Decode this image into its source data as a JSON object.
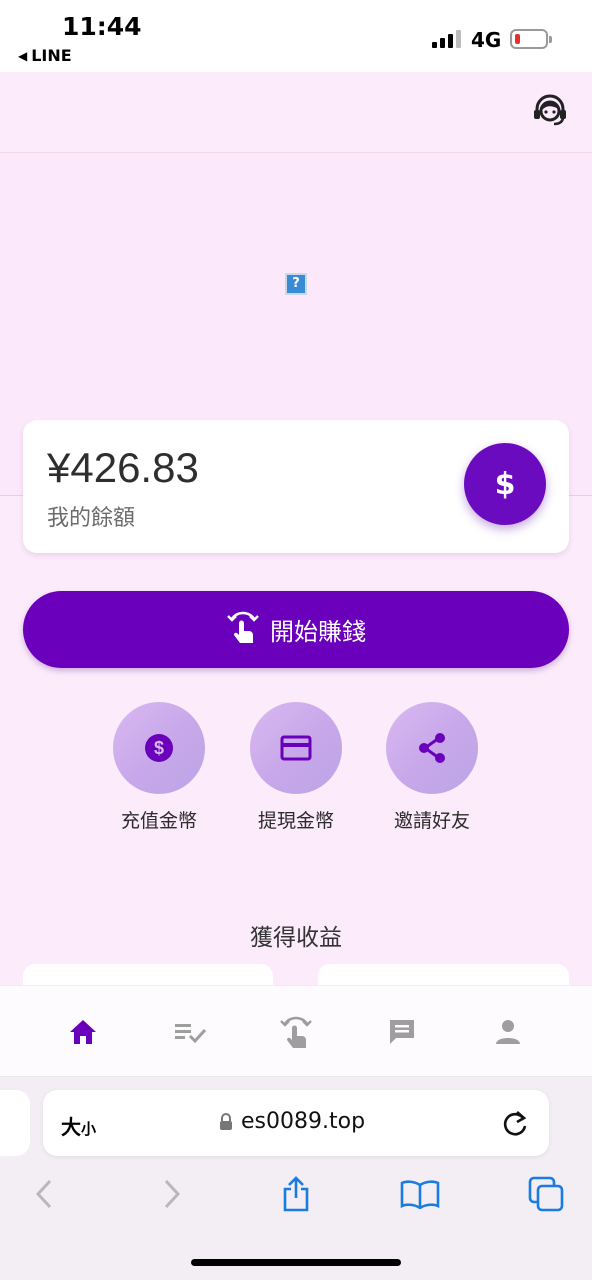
{
  "status_bar": {
    "time": "11:44",
    "back_app": "LINE",
    "network": "4G",
    "battery_color": "#e5302b"
  },
  "header": {
    "support_icon": "headset-icon"
  },
  "banner": {
    "broken_image_glyph": "?"
  },
  "balance": {
    "amount": "¥426.83",
    "label": "我的餘額",
    "fab_symbol": "$"
  },
  "earn_button": {
    "label": "開始賺錢",
    "icon": "tap-gesture-icon"
  },
  "actions": [
    {
      "label": "充值金幣",
      "icon": "dollar-circle-icon"
    },
    {
      "label": "提現金幣",
      "icon": "credit-card-icon"
    },
    {
      "label": "邀請好友",
      "icon": "share-icon"
    }
  ],
  "section": {
    "title": "獲得收益"
  },
  "tab_bar": {
    "items": [
      {
        "icon": "home-icon",
        "active": true
      },
      {
        "icon": "task-list-icon",
        "active": false
      },
      {
        "icon": "tap-gesture-icon",
        "active": false
      },
      {
        "icon": "message-icon",
        "active": false
      },
      {
        "icon": "person-icon",
        "active": false
      }
    ],
    "active_color": "#6a00bb",
    "inactive_color": "#9e9e9e"
  },
  "browser": {
    "text_size_big": "大",
    "text_size_small": "小",
    "url": "es0089.top",
    "accent_color": "#1a7be0"
  },
  "colors": {
    "primary": "#6a00bb",
    "background": "#fcebfb"
  }
}
